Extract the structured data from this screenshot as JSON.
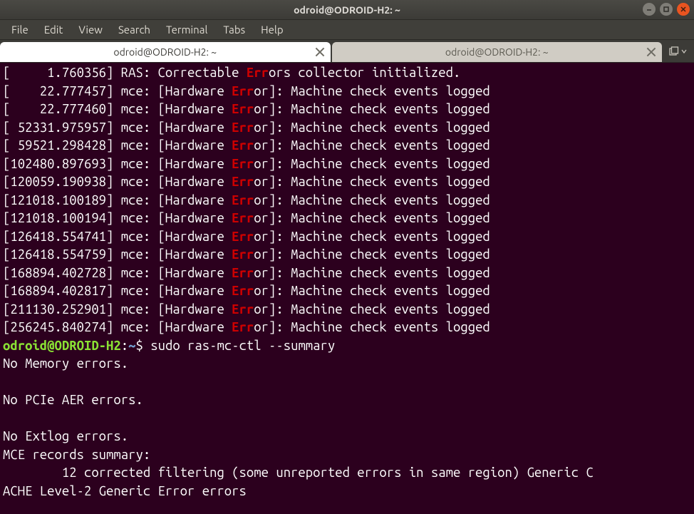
{
  "window": {
    "title": "odroid@ODROID-H2: ~"
  },
  "menu": {
    "items": [
      "File",
      "Edit",
      "View",
      "Search",
      "Terminal",
      "Tabs",
      "Help"
    ]
  },
  "tabs": {
    "list": [
      {
        "label": "odroid@ODROID-H2: ~",
        "active": true
      },
      {
        "label": "odroid@ODROID-H2: ~",
        "active": false
      }
    ]
  },
  "prompt": {
    "user_host": "odroid@ODROID-H2",
    "sep": ":",
    "path": "~",
    "dollar": "$"
  },
  "command": " sudo ras-mc-ctl --summary",
  "lines": [
    {
      "type": "ras_init",
      "ts": "     1.760356",
      "text_pre": "RAS: Correctable ",
      "err": "Err",
      "text_post": "ors collector initialized."
    },
    {
      "type": "mce",
      "ts": "    22.777457"
    },
    {
      "type": "mce",
      "ts": "    22.777460"
    },
    {
      "type": "mce",
      "ts": " 52331.975957",
      "nobracketpad": true
    },
    {
      "type": "mce",
      "ts": " 59521.298428",
      "nobracketpad": true
    },
    {
      "type": "mce",
      "ts": "102480.897693"
    },
    {
      "type": "mce",
      "ts": "120059.190938"
    },
    {
      "type": "mce",
      "ts": "121018.100189"
    },
    {
      "type": "mce",
      "ts": "121018.100194"
    },
    {
      "type": "mce",
      "ts": "126418.554741"
    },
    {
      "type": "mce",
      "ts": "126418.554759"
    },
    {
      "type": "mce",
      "ts": "168894.402728"
    },
    {
      "type": "mce",
      "ts": "168894.402817"
    },
    {
      "type": "mce",
      "ts": "211130.252901"
    },
    {
      "type": "mce",
      "ts": "256245.840274"
    }
  ],
  "mce_template": {
    "prefix": " mce: [Hardware ",
    "err": "Err",
    "suffix": "or]: Machine check events logged"
  },
  "output": [
    "No Memory errors.",
    "",
    "No PCIe AER errors.",
    "",
    "No Extlog errors.",
    "MCE records summary:",
    "\t12 corrected filtering (some unreported errors in same region) Generic C",
    "ACHE Level-2 Generic Error errors"
  ]
}
